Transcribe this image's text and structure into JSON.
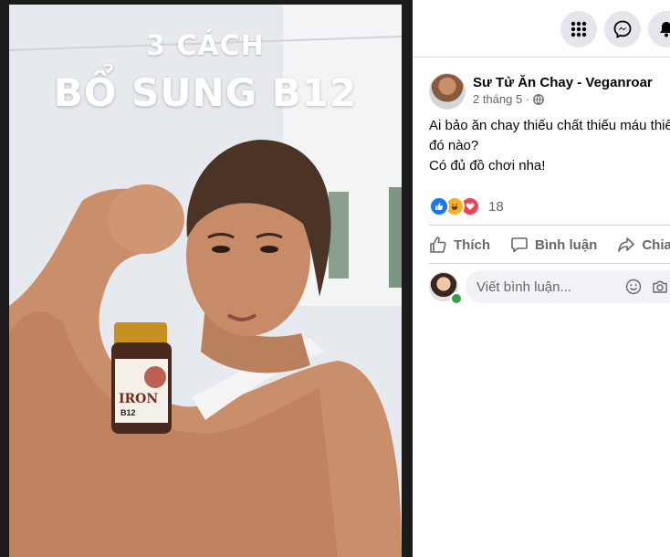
{
  "photo": {
    "overlay_line1": "3 CÁCH",
    "overlay_line2": "BỔ SUNG B12",
    "bottle_brand": "IRON",
    "bottle_sub": "B12"
  },
  "topbar": {
    "icons": [
      "grid-menu-icon",
      "messenger-icon",
      "notification-bell-icon"
    ]
  },
  "post": {
    "page_name": "Sư Tử Ăn Chay - Veganroar",
    "time": "2 tháng 5 ·",
    "privacy_icon": "globe-icon",
    "text_lines": [
      "Ai bảo ăn chay thiếu chất thiếu máu thiếu",
      "đó nào?",
      "Có đủ đồ chơi nha!"
    ],
    "reaction_icons": [
      "like-reaction-icon",
      "haha-reaction-icon",
      "love-reaction-icon"
    ],
    "reaction_count": "18"
  },
  "actions": {
    "like": "Thích",
    "comment": "Bình luận",
    "share": "Chia"
  },
  "comment": {
    "placeholder": "Viết bình luận..."
  },
  "colors": {
    "accent": "#1877f2",
    "secondary_text": "#65676b",
    "love": "#f33e58",
    "haha": "#f7b125",
    "online": "#31a24c"
  }
}
